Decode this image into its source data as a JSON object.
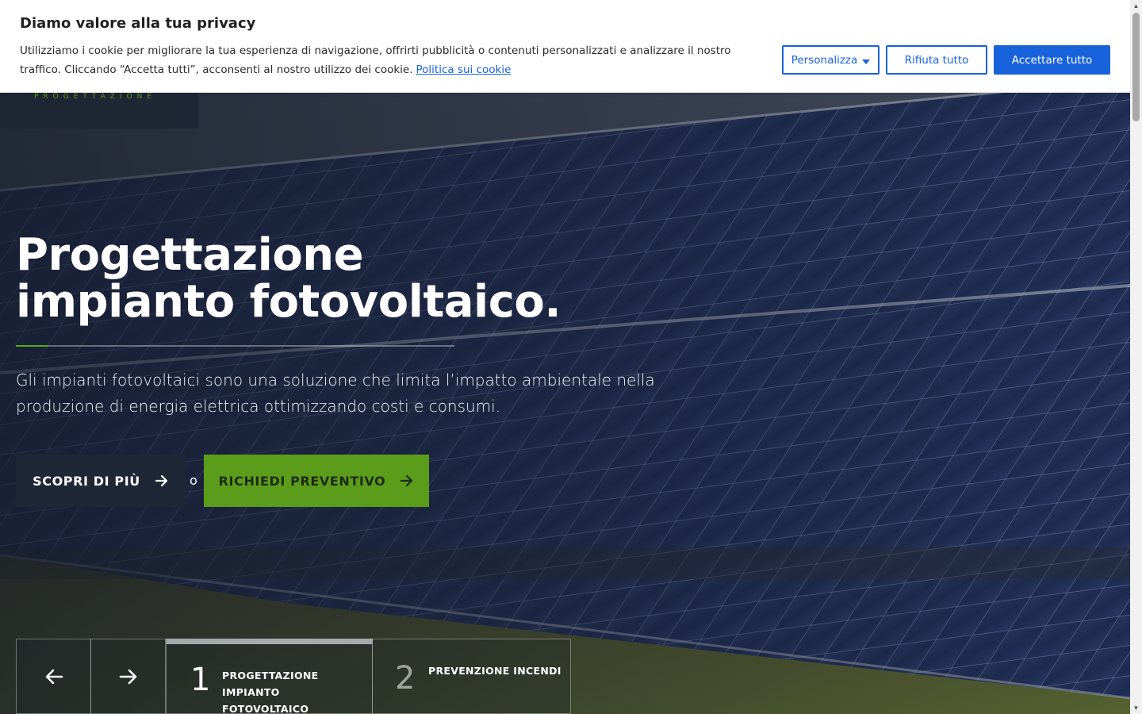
{
  "cookie_banner": {
    "title": "Diamo valore alla tua privacy",
    "text": "Utilizziamo i cookie per migliorare la tua esperienza di navigazione, offrirti pubblicità o contenuti personalizzati e analizzare il nostro traffico. Cliccando “Accetta tutti”, acconsenti al nostro utilizzo dei cookie.",
    "policy_link": "Politica sui cookie",
    "customize_label": "Personalizza",
    "reject_label": "Rifiuta tutto",
    "accept_label": "Accettare tutto",
    "accent_color": "#1863dc"
  },
  "header": {
    "logo_tagline": "PROGETTAZIONE"
  },
  "hero": {
    "title": "Progettazione impianto fotovoltaico.",
    "subtitle": "Gli impianti fotovoltaici sono una soluzione che limita l’impatto ambientale nella produzione di energia elettrica ottimizzando costi e consumi.",
    "cta_more": "SCOPRI DI PIÙ",
    "or_text": "o",
    "cta_quote": "RICHIEDI PREVENTIVO",
    "brand_green": "#5b9d1a"
  },
  "slider": {
    "prev_icon": "arrow-left-icon",
    "next_icon": "arrow-right-icon",
    "tabs": [
      {
        "number": "1",
        "label": "PROGETTAZIONE IMPIANTO FOTOVOLTAICO",
        "active": true
      },
      {
        "number": "2",
        "label": "PREVENZIONE INCENDI",
        "active": false
      }
    ]
  }
}
